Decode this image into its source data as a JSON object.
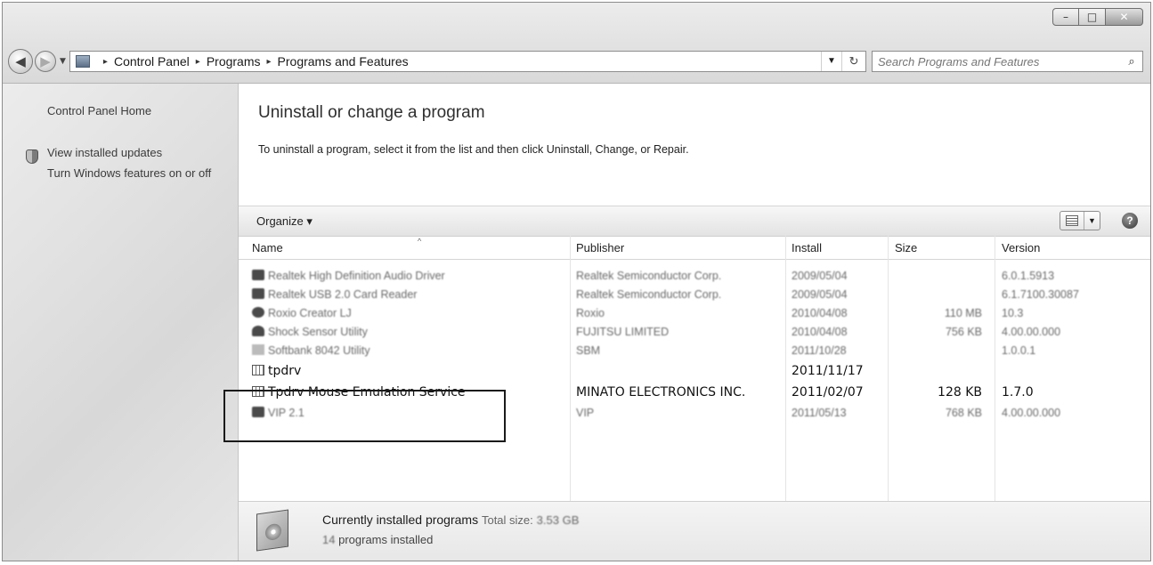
{
  "window": {
    "minimize_glyph": "–",
    "maximize_glyph": "□",
    "close_glyph": "✕"
  },
  "address": {
    "crumbs": [
      "Control Panel",
      "Programs",
      "Programs and Features"
    ],
    "separator": "▸",
    "dropdown_glyph": "▼",
    "refresh_glyph": "↻"
  },
  "search": {
    "placeholder": "Search Programs and Features",
    "icon_glyph": "⌕"
  },
  "nav": {
    "back_glyph": "◀",
    "forward_glyph": "▶",
    "recent_glyph": "▼"
  },
  "sidebar": {
    "items": [
      {
        "label": "Control Panel Home"
      },
      {
        "label": "View installed updates"
      },
      {
        "label": "Turn Windows features on or off"
      }
    ]
  },
  "main": {
    "title": "Uninstall or change a program",
    "subtitle": "To uninstall a program, select it from the list and then click Uninstall, Change, or Repair."
  },
  "toolbar": {
    "organize": "Organize ▾",
    "view_dropdown_glyph": "▼",
    "help_glyph": "?"
  },
  "table": {
    "columns": {
      "name": "Name",
      "publisher": "Publisher",
      "install": "Install",
      "size": "Size",
      "version": "Version"
    },
    "sort_glyph": "^",
    "rows": [
      {
        "name": "Realtek High Definition Audio Driver",
        "publisher": "Realtek Semiconductor Corp.",
        "install": "2009/05/04",
        "size": "",
        "version": "6.0.1.5913"
      },
      {
        "name": "Realtek USB 2.0 Card Reader",
        "publisher": "Realtek Semiconductor Corp.",
        "install": "2009/05/04",
        "size": "",
        "version": "6.1.7100.30087"
      },
      {
        "name": "Roxio Creator LJ",
        "publisher": "Roxio",
        "install": "2010/04/08",
        "size": "110 MB",
        "version": "10.3"
      },
      {
        "name": "Shock Sensor Utility",
        "publisher": "FUJITSU LIMITED",
        "install": "2010/04/08",
        "size": "756 KB",
        "version": "4.00.00.000"
      },
      {
        "name": "Softbank 8042 Utility",
        "publisher": "SBM",
        "install": "2011/10/28",
        "size": "",
        "version": "1.0.0.1"
      },
      {
        "name": "tpdrv",
        "publisher": "",
        "install": "2011/11/17",
        "size": "",
        "version": ""
      },
      {
        "name": "Tpdrv Mouse Emulation Service",
        "publisher": "MINATO ELECTRONICS INC.",
        "install": "2011/02/07",
        "size": "128 KB",
        "version": "1.7.0"
      },
      {
        "name": "VIP 2.1",
        "publisher": "VIP",
        "install": "2011/05/13",
        "size": "768 KB",
        "version": "4.00.00.000"
      }
    ]
  },
  "details": {
    "title": "Currently installed programs",
    "total_label": "Total size:",
    "total_value": "3.53 GB",
    "count": "14",
    "count_suffix": "programs installed"
  }
}
